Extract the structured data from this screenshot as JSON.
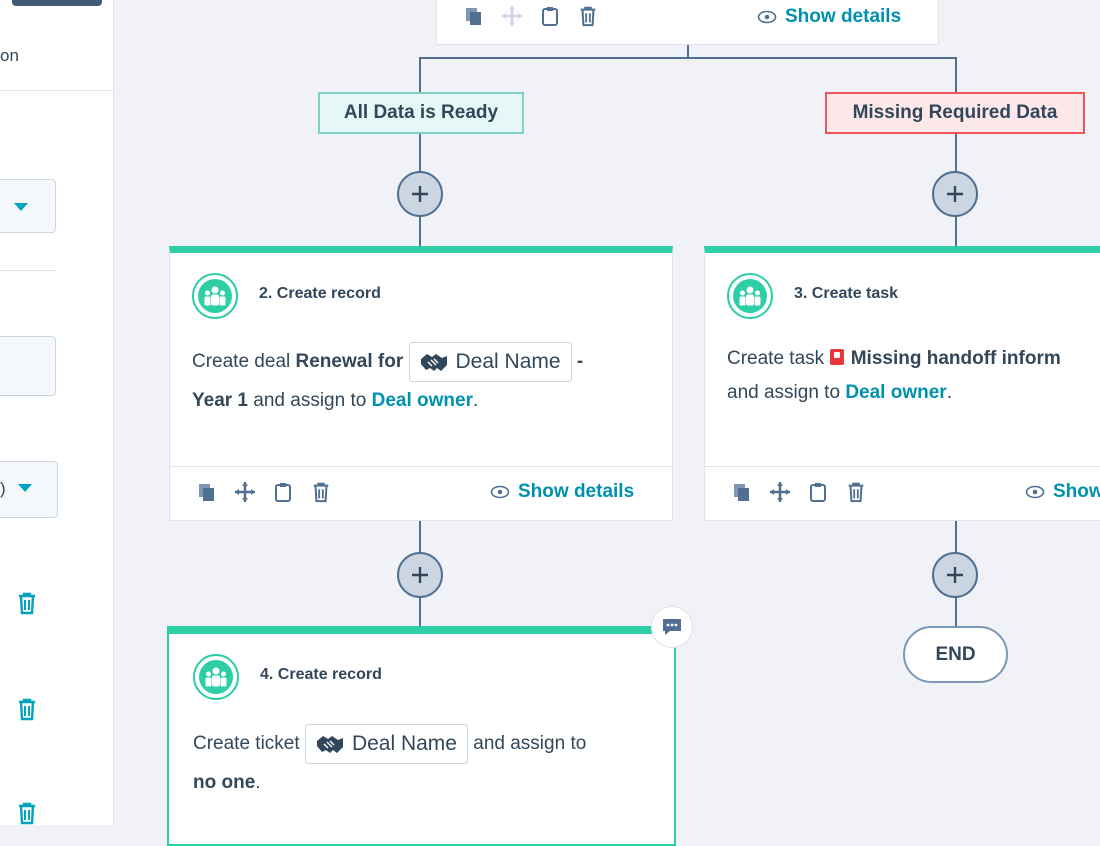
{
  "left_panel": {
    "partial_label": "on",
    "partial_dropdown_text": ")"
  },
  "top_card": {
    "show_details": "Show details"
  },
  "branches": {
    "ready_label": "All Data is Ready",
    "missing_label": "Missing Required Data"
  },
  "card2": {
    "title": "2. Create record",
    "text1": "Create deal",
    "bold1": "Renewal for",
    "token": "Deal Name",
    "dash": "-",
    "bold2": "Year 1",
    "text2": "and assign to",
    "owner": "Deal owner",
    "period": ".",
    "show_details": "Show details"
  },
  "card3": {
    "title": "3. Create task",
    "text1": "Create task",
    "bold1": "Missing handoff inform",
    "text2": "and assign to",
    "owner": "Deal owner",
    "period": ".",
    "show_details": "Show"
  },
  "card4": {
    "title": "4. Create record",
    "text1": "Create ticket",
    "token": "Deal Name",
    "text2": "and assign to",
    "bold1": "no one",
    "period": "."
  },
  "end_label": "END",
  "colors": {
    "accent": "#2ecfa6",
    "link": "#0091ae",
    "error": "#f2545b",
    "connector": "#516f90"
  }
}
